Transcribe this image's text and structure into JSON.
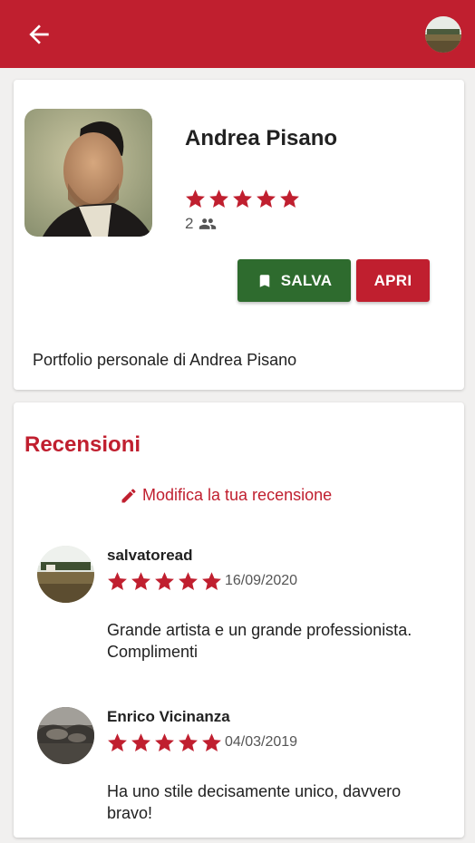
{
  "colors": {
    "primary": "#c01f2f",
    "save_green": "#2e6b2e",
    "star": "#c01f2f"
  },
  "appbar": {
    "back_icon": "arrow-left-icon",
    "avatar": "user-avatar"
  },
  "profile": {
    "name": "Andrea Pisano",
    "rating": 5,
    "followers_count": "2",
    "followers_icon": "people-icon",
    "save_label": "SALVA",
    "save_icon": "bookmark-icon",
    "open_label": "APRI",
    "description": "Portfolio personale di Andrea Pisano"
  },
  "reviews_section": {
    "title": "Recensioni",
    "edit_label": "Modifica la tua recensione",
    "edit_icon": "pencil-icon",
    "reviews": [
      {
        "user": "salvatoread",
        "rating": 5,
        "date": "16/09/2020",
        "text": "Grande artista e un grande professionista. Complimenti"
      },
      {
        "user": "Enrico Vicinanza",
        "rating": 5,
        "date": "04/03/2019",
        "text": "Ha uno stile decisamente unico, davvero bravo!"
      }
    ]
  }
}
